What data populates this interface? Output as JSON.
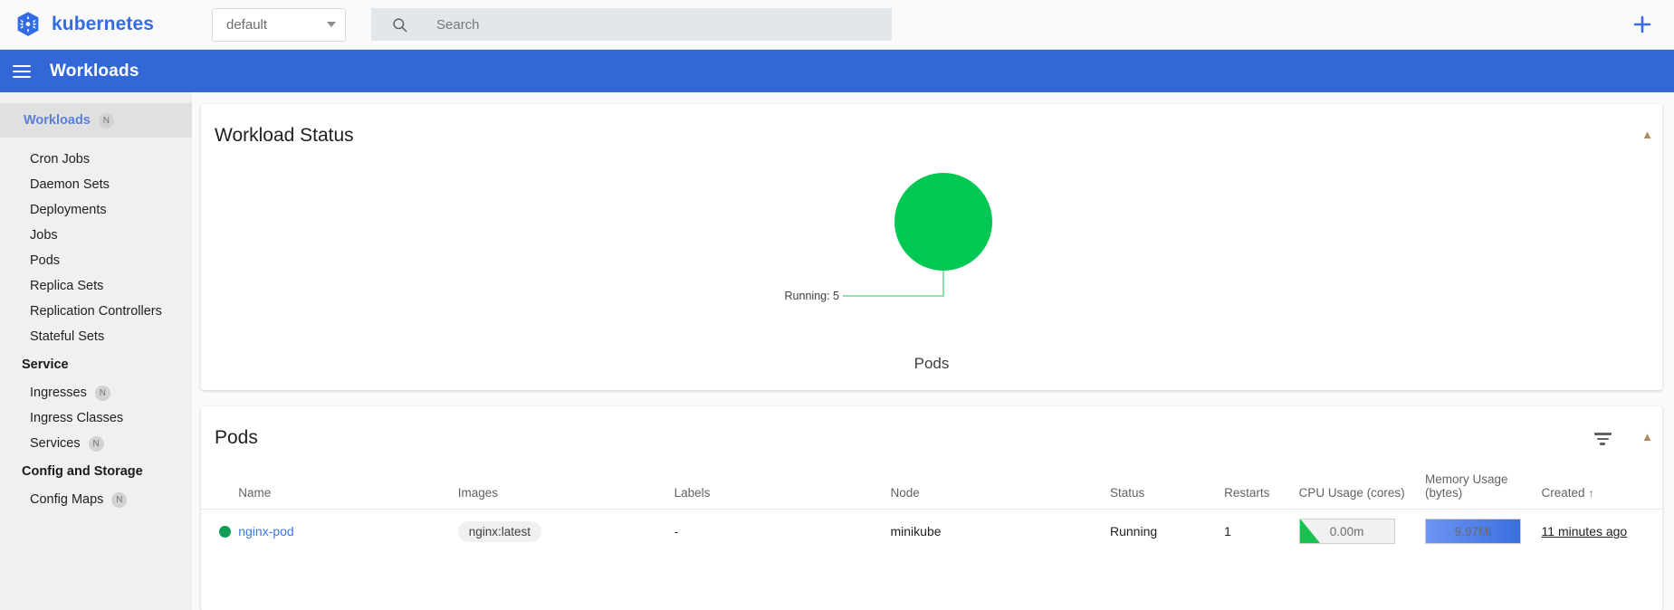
{
  "topbar": {
    "brand": "kubernetes",
    "logo_icon": "kubernetes-helm-logo",
    "namespace": {
      "value": "default",
      "caret_icon": "chevron-down-icon"
    },
    "search": {
      "icon": "search-icon",
      "placeholder": "Search",
      "value": ""
    },
    "add_button": {
      "icon": "plus-icon",
      "label": "+"
    }
  },
  "toolbar": {
    "menu_icon": "hamburger-menu-icon",
    "title": "Workloads"
  },
  "sidebar": {
    "items": [
      {
        "label": "Workloads",
        "badge": "N",
        "active": true,
        "type": "item"
      },
      {
        "label": "Cron Jobs",
        "badge": "",
        "active": false,
        "type": "item"
      },
      {
        "label": "Daemon Sets",
        "badge": "",
        "active": false,
        "type": "item"
      },
      {
        "label": "Deployments",
        "badge": "",
        "active": false,
        "type": "item"
      },
      {
        "label": "Jobs",
        "badge": "",
        "active": false,
        "type": "item"
      },
      {
        "label": "Pods",
        "badge": "",
        "active": false,
        "type": "item"
      },
      {
        "label": "Replica Sets",
        "badge": "",
        "active": false,
        "type": "item"
      },
      {
        "label": "Replication Controllers",
        "badge": "",
        "active": false,
        "type": "item"
      },
      {
        "label": "Stateful Sets",
        "badge": "",
        "active": false,
        "type": "item"
      },
      {
        "label": "Service",
        "badge": "",
        "active": false,
        "type": "section"
      },
      {
        "label": "Ingresses",
        "badge": "N",
        "active": false,
        "type": "item"
      },
      {
        "label": "Ingress Classes",
        "badge": "",
        "active": false,
        "type": "item"
      },
      {
        "label": "Services",
        "badge": "N",
        "active": false,
        "type": "item"
      },
      {
        "label": "Config and Storage",
        "badge": "",
        "active": false,
        "type": "section"
      },
      {
        "label": "Config Maps",
        "badge": "N",
        "active": false,
        "type": "item"
      }
    ]
  },
  "status_card": {
    "title": "Workload Status",
    "collapse_icon": "chevron-up-icon",
    "caption": "Pods",
    "slice_label": "Running: 5"
  },
  "chart_data": {
    "type": "pie",
    "title": "Workload Status",
    "subtitle": "Pods",
    "categories": [
      "Running"
    ],
    "values": [
      5
    ],
    "labels": [
      "Running: 5"
    ],
    "colors": [
      "#00c853"
    ],
    "leader_line_color": "#8fdfa9",
    "legend": "none",
    "total": 5
  },
  "pods_card": {
    "title": "Pods",
    "filter_icon": "filter-icon",
    "collapse_icon": "chevron-up-icon",
    "columns": [
      "",
      "Name",
      "Images",
      "Labels",
      "Node",
      "Status",
      "Restarts",
      "CPU Usage (cores)",
      "Memory Usage (bytes)",
      "Created"
    ],
    "sort_column": "Created",
    "sort_arrow": "↑",
    "rows": [
      {
        "status_icon": "status-dot-running",
        "name": "nginx-pod",
        "image": "nginx:latest",
        "labels": "-",
        "node": "minikube",
        "status": "Running",
        "restarts": "1",
        "cpu": "0.00m",
        "memory": "9.97Mi",
        "created": "11 minutes ago"
      }
    ]
  },
  "colors": {
    "brand_blue": "#326ce5",
    "toolbar_blue": "#3367d6",
    "running_green": "#00c853",
    "status_dot_green": "#0f9d58",
    "link_blue": "#3b78e7",
    "memory_bar_blue": "#3a6fe0",
    "cpu_wedge_green": "#19c24f"
  }
}
